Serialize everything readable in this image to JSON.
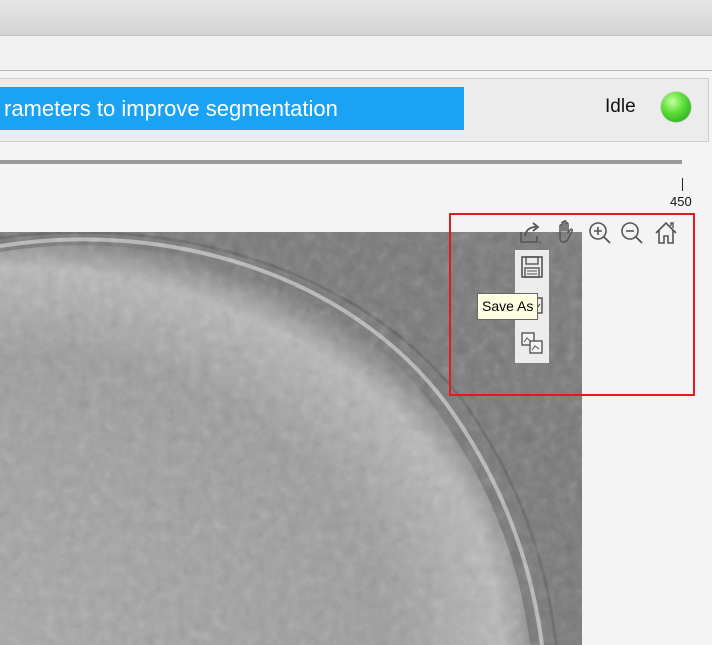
{
  "status_bar": {
    "message": "rameters to improve segmentation",
    "status_label": "Idle",
    "status_lamp_color": "#3cd12f"
  },
  "axis": {
    "tick_label": "450"
  },
  "image": {
    "description_icon": "microscopy-image"
  },
  "axes_toolbar": {
    "buttons": [
      {
        "name": "export-icon",
        "tooltip": ""
      },
      {
        "name": "pan-hand-icon",
        "tooltip": ""
      },
      {
        "name": "zoom-in-icon",
        "tooltip": ""
      },
      {
        "name": "zoom-out-icon",
        "tooltip": ""
      },
      {
        "name": "home-icon",
        "tooltip": ""
      }
    ],
    "export_menu": [
      {
        "name": "save-as-icon"
      },
      {
        "name": "copy-image-icon"
      },
      {
        "name": "copy-vector-icon"
      }
    ],
    "tooltip": "Save As"
  },
  "colors": {
    "banner": "#1aa3f4",
    "highlight": "#e11b1b"
  }
}
